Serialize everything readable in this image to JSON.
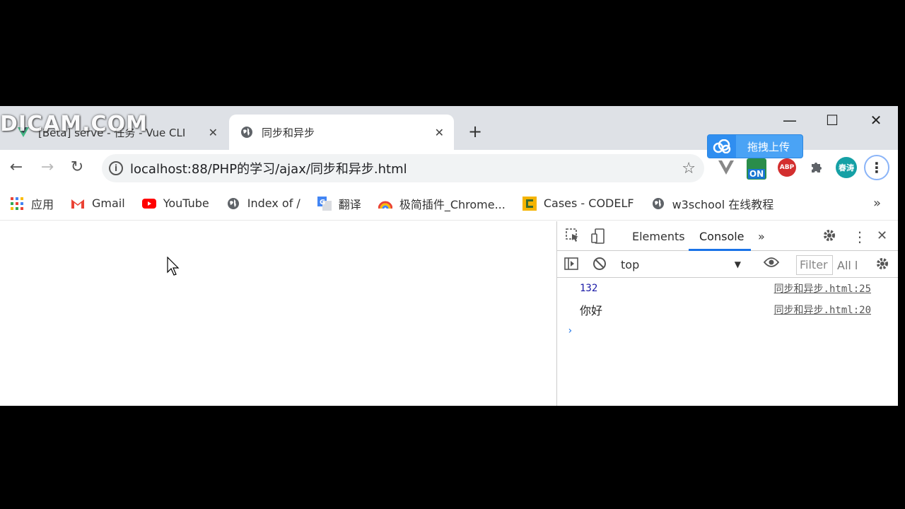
{
  "watermark": "DICAM.COM",
  "tabs": [
    {
      "label": "[Beta] serve - 任务 - Vue CLI",
      "close": "✕"
    },
    {
      "label": "同步和异步",
      "close": "✕"
    }
  ],
  "new_tab": "+",
  "window_controls": {
    "minimize": "—",
    "maximize": "☐",
    "close": "✕"
  },
  "nav": {
    "back": "←",
    "forward": "→",
    "reload": "↻"
  },
  "omnibox": {
    "info": "i",
    "url": "localhost:88/PHP的学习/ajax/同步和异步.html",
    "star": "☆"
  },
  "upload_badge": {
    "label": "拖拽上传"
  },
  "extensions": {
    "on_label": "ON",
    "abp_label": "ABP",
    "avatar_label": "春涛",
    "menu": "⋮"
  },
  "bookmarks": [
    {
      "label": "应用"
    },
    {
      "label": "Gmail"
    },
    {
      "label": "YouTube"
    },
    {
      "label": "Index of /"
    },
    {
      "label": "翻译"
    },
    {
      "label": "极简插件_Chrome..."
    },
    {
      "label": "Cases - CODELF"
    },
    {
      "label": "w3school 在线教程"
    }
  ],
  "bookmarks_more": "»",
  "devtools": {
    "tabs": {
      "elements": "Elements",
      "console": "Console",
      "more": "»"
    },
    "context": "top",
    "filter_placeholder": "Filter",
    "levels": "All l",
    "logs": [
      {
        "message": "132",
        "source": "同步和异步.html:25"
      },
      {
        "message": "你好",
        "source": "同步和异步.html:20"
      }
    ],
    "prompt": "›"
  },
  "colors": {
    "accent": "#1a73e8",
    "number_log": "#1a1aa6",
    "upload_badge": "#4aa3f5"
  }
}
